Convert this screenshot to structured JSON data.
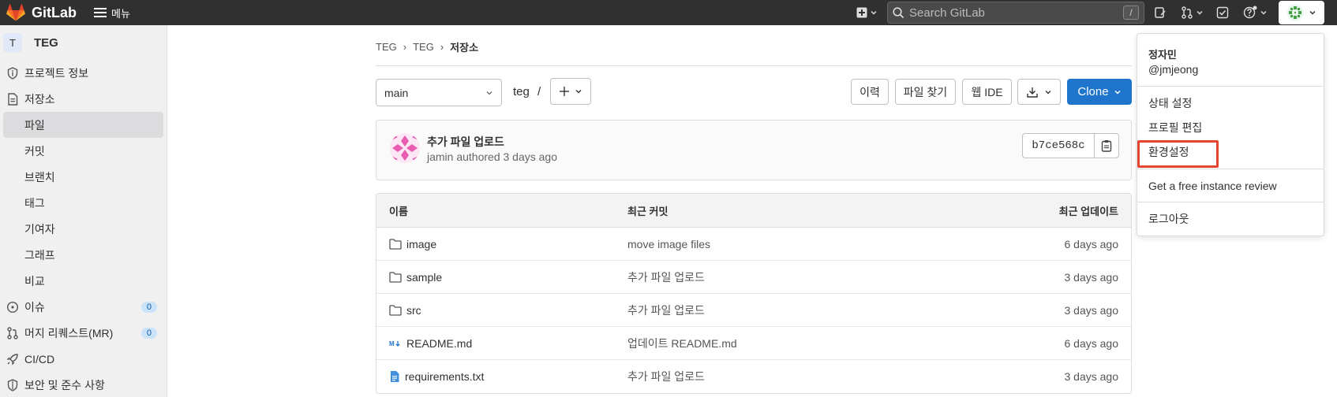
{
  "topbar": {
    "brand": "GitLab",
    "menu_label": "메뉴",
    "search_placeholder": "Search GitLab",
    "search_shortcut": "/"
  },
  "sidebar": {
    "project_initial": "T",
    "project_name": "TEG",
    "items": [
      {
        "label": "프로젝트 정보",
        "icon": "info-icon"
      },
      {
        "label": "저장소",
        "icon": "document-icon"
      }
    ],
    "repo_subitems": [
      "파일",
      "커밋",
      "브랜치",
      "태그",
      "기여자",
      "그래프",
      "비교"
    ],
    "issues_label": "이슈",
    "issues_count": "0",
    "mr_label": "머지 리퀘스트(MR)",
    "mr_count": "0",
    "cicd_label": "CI/CD",
    "security_label": "보안 및 준수 사항"
  },
  "breadcrumb": [
    "TEG",
    "TEG",
    "저장소"
  ],
  "repo": {
    "branch": "main",
    "path": "teg",
    "path_sep": "/",
    "buttons": {
      "history": "이력",
      "find_file": "파일 찾기",
      "web_ide": "웹 IDE",
      "clone": "Clone"
    }
  },
  "commit": {
    "title": "추가 파일 업로드",
    "meta": "jamin authored 3 days ago",
    "sha": "b7ce568c"
  },
  "table": {
    "headers": [
      "이름",
      "최근 커밋",
      "최근 업데이트"
    ],
    "rows": [
      {
        "name": "image",
        "type": "folder",
        "commit": "move image files",
        "updated": "6 days ago"
      },
      {
        "name": "sample",
        "type": "folder",
        "commit": "추가 파일 업로드",
        "updated": "3 days ago"
      },
      {
        "name": "src",
        "type": "folder",
        "commit": "추가 파일 업로드",
        "updated": "3 days ago"
      },
      {
        "name": "README.md",
        "type": "markdown",
        "commit": "업데이트 README.md",
        "updated": "6 days ago"
      },
      {
        "name": "requirements.txt",
        "type": "text",
        "commit": "추가 파일 업로드",
        "updated": "3 days ago"
      }
    ]
  },
  "user_menu": {
    "display_name": "정자민",
    "username": "@jmjeong",
    "items": [
      "상태 설정",
      "프로필 편집",
      "환경설정",
      "Get a free instance review",
      "로그아웃"
    ],
    "highlighted_item": "환경설정"
  },
  "colors": {
    "topbar": "#303030",
    "primary": "#1f75cb",
    "highlight": "#e5452f",
    "logo_orange": "#fc6d26"
  }
}
